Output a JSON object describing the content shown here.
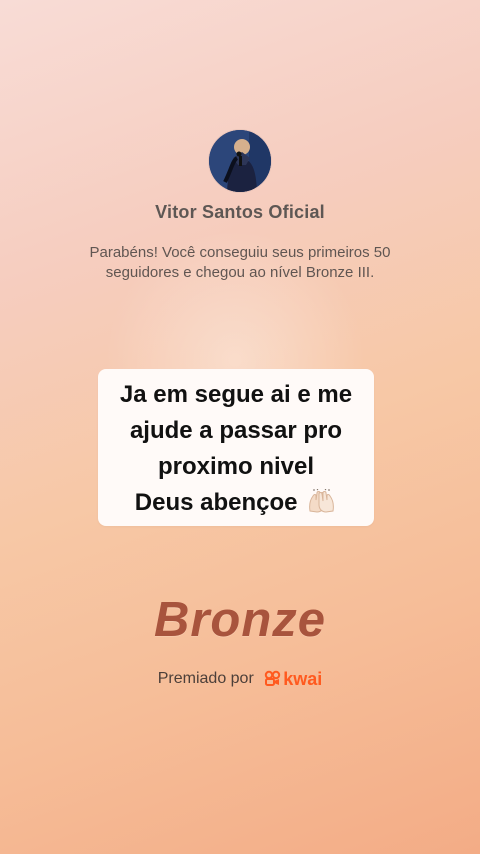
{
  "profile": {
    "name": "Vitor Santos Oficial"
  },
  "message": {
    "line1": "Parabéns! Você conseguiu seus primeiros 50",
    "line2": "seguidores e chegou ao nível Bronze III."
  },
  "comment": {
    "line1": "Ja em segue ai e me",
    "line2": "ajude a passar pro",
    "line3": "proximo nivel",
    "line4": "Deus abençoe"
  },
  "badge": {
    "label": "Bronze"
  },
  "award": {
    "prefix": "Premiado por",
    "brand": "kwai"
  },
  "colors": {
    "badge": "#a8543d",
    "brand": "#ff5a1f",
    "card": "#fffaf8"
  },
  "icons": {
    "avatar": "profile-photo",
    "emoji": "raised-hands-icon",
    "brand_logo": "kwai-logo-icon"
  }
}
